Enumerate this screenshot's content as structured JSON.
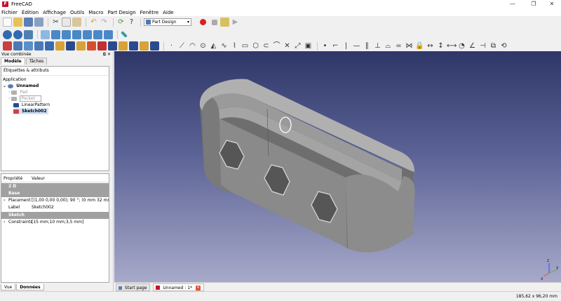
{
  "app": {
    "title": "FreeCAD",
    "icon": "freecad-logo"
  },
  "window_controls": [
    "—",
    "❐",
    "✕"
  ],
  "menu": [
    "Fichier",
    "Édition",
    "Affichage",
    "Outils",
    "Macro",
    "Part Design",
    "Fenêtre",
    "Aide"
  ],
  "toolbar": {
    "workbench": "Part Design"
  },
  "combo": {
    "title": "Vue combinée",
    "controls": "⧉ ✕",
    "tabs": [
      "Modèle",
      "Tâches"
    ],
    "tree_header": "Étiquettes & attributs",
    "tree": {
      "application": "Application",
      "document": "Unnamed",
      "pad": "Pad",
      "pocket": "Pocket",
      "pattern": "LinearPattern",
      "sketch": "Sketch002"
    },
    "props": {
      "col_prop": "Propriété",
      "col_val": "Valeur",
      "group_2d": "2 D",
      "group_base": "Base",
      "placement_key": "Placement",
      "placement_val": "[(1,00 0,00 0,00); 90 °; (0 mm  32 mm",
      "label_key": "Label",
      "label_val": "Sketch002",
      "group_sketch": "Sketch",
      "constraints_key": "Constraints",
      "constraints_val": "[15 mm;10 mm;3,5 mm]"
    },
    "bottom_tabs": [
      "Vue",
      "Données"
    ]
  },
  "view_tabs": {
    "start": "Start page",
    "doc": "Unnamed : 1*"
  },
  "axis": {
    "z": "z",
    "y": "y",
    "x": "x"
  },
  "status": {
    "dims": "185,62 x 96,20 mm"
  },
  "colors": {
    "accent": "#c8102e",
    "bg_top": "#2f3668",
    "bg_bottom": "#a7a9c9",
    "part": "#8c8c8c"
  }
}
